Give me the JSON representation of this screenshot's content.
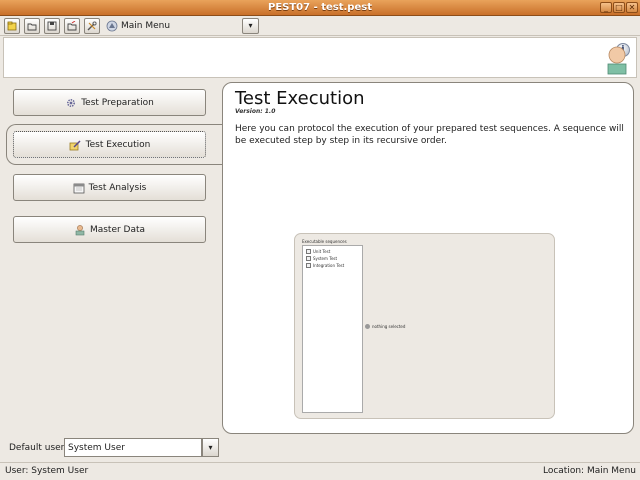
{
  "window": {
    "title": "PEST07 - test.pest",
    "buttons": [
      "_",
      "□",
      "✕"
    ]
  },
  "toolbar": {
    "menu_label": "Main Menu",
    "dropdown_arrow": "▾",
    "icons": [
      "new-file-icon",
      "open-folder-icon",
      "save-icon",
      "export-icon",
      "tools-icon",
      "main-menu-icon"
    ]
  },
  "header": {
    "info_label": "i",
    "icons": [
      "info-icon",
      "user-avatar-icon"
    ]
  },
  "nav": {
    "items": [
      {
        "label": "Test Preparation",
        "icon": "gear-icon"
      },
      {
        "label": "Test Execution",
        "icon": "pencil-icon"
      },
      {
        "label": "Test Analysis",
        "icon": "calendar-icon"
      },
      {
        "label": "Master Data",
        "icon": "person-icon"
      }
    ]
  },
  "main": {
    "title": "Test Execution",
    "version": "Version: 1.0",
    "description": "Here you can protocol the execution of your prepared test sequences. A sequence will be executed step by step in its recursive order.",
    "preview": {
      "list_title": "Executable sequences",
      "items": [
        "Unit Test",
        "System Test",
        "Integration Test"
      ],
      "empty_text": "nothing selected"
    }
  },
  "user": {
    "label": "Default user:",
    "value": "System User",
    "dropdown_arrow": "▾"
  },
  "status": {
    "left": "User: System User",
    "right": "Location: Main Menu"
  },
  "colors": {
    "titlebar": "#d5853d",
    "background": "#ede9e3",
    "panel": "#ffffff"
  }
}
